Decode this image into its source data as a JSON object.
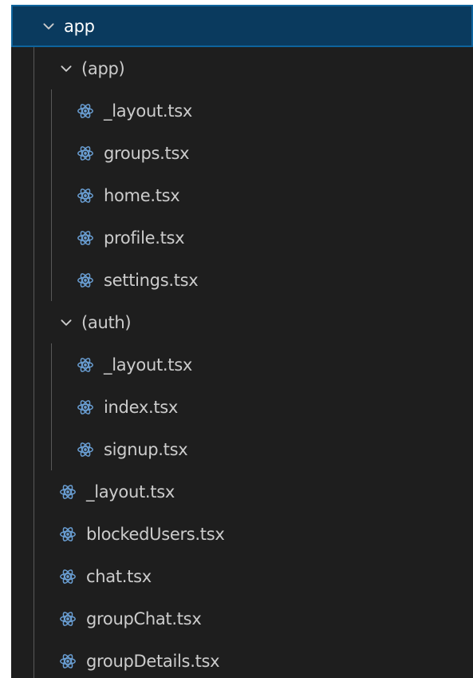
{
  "explorer": {
    "root": {
      "label": "app",
      "expanded": true,
      "selected": true
    },
    "groups": [
      {
        "label": "(app)",
        "expanded": true,
        "files": [
          "_layout.tsx",
          "groups.tsx",
          "home.tsx",
          "profile.tsx",
          "settings.tsx"
        ]
      },
      {
        "label": "(auth)",
        "expanded": true,
        "files": [
          "_layout.tsx",
          "index.tsx",
          "signup.tsx"
        ]
      }
    ],
    "files": [
      "_layout.tsx",
      "blockedUsers.tsx",
      "chat.tsx",
      "groupChat.tsx",
      "groupDetails.tsx"
    ]
  },
  "icons": {
    "folder_expanded": "chevron-down-icon",
    "tsx_file": "react-icon"
  },
  "colors": {
    "background": "#1e1e1e",
    "selected_row": "#0a3a5e",
    "selected_border": "#0e639c",
    "react_icon": "#6a9fd4",
    "text": "#cccccc"
  }
}
